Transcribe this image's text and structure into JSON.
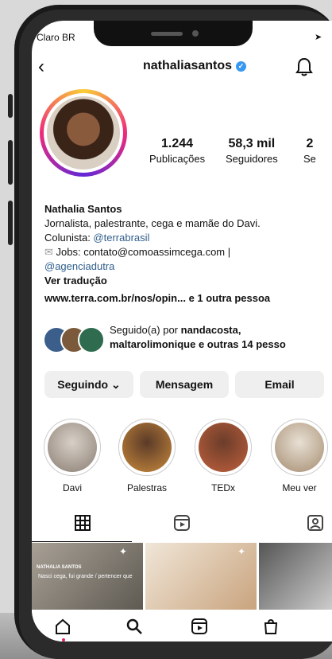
{
  "status": {
    "carrier": "Claro BR"
  },
  "header": {
    "username": "nathaliasantos"
  },
  "stats": [
    {
      "number": "1.244",
      "label": "Publicações"
    },
    {
      "number": "58,3 mil",
      "label": "Seguidores"
    },
    {
      "number": "2",
      "label": "Se"
    }
  ],
  "bio": {
    "name": "Nathalia Santos",
    "line1": "Jornalista, palestrante, cega e mamãe do Davi.",
    "colunista_prefix": "Colunista: ",
    "colunista_link": "@terrabrasil",
    "jobs": "Jobs: contato@comoassimcega.com |",
    "agency_link": "@agenciadutra",
    "translate": "Ver tradução",
    "website": "www.terra.com.br/nos/opin...",
    "website_suffix": "e 1 outra pessoa"
  },
  "followed_by": {
    "prefix": "Seguido(a) por ",
    "user1": "nandacosta,",
    "line2": "maltarolimonique e outras 14 pesso"
  },
  "actions": {
    "following": "Seguindo ⌄",
    "message": "Mensagem",
    "email": "Email"
  },
  "highlights": [
    {
      "label": "Davi"
    },
    {
      "label": "Palestras"
    },
    {
      "label": "TEDx"
    },
    {
      "label": "Meu ver"
    }
  ],
  "grid": {
    "post1_brand": "NATHALIA SANTOS",
    "post1_caption": "Nasci cega, fui grande / pertencer que"
  },
  "icons": {
    "back": "back-icon",
    "verified": "verified-badge-icon",
    "bell": "bell-icon",
    "grid": "grid-icon",
    "reels": "reels-icon",
    "tagged": "tagged-icon",
    "home": "home-icon",
    "search": "search-icon",
    "shop": "shop-icon"
  },
  "colors": {
    "link": "#2f5e8c",
    "verified": "#3897f0",
    "active_dot": "#e0245e"
  }
}
